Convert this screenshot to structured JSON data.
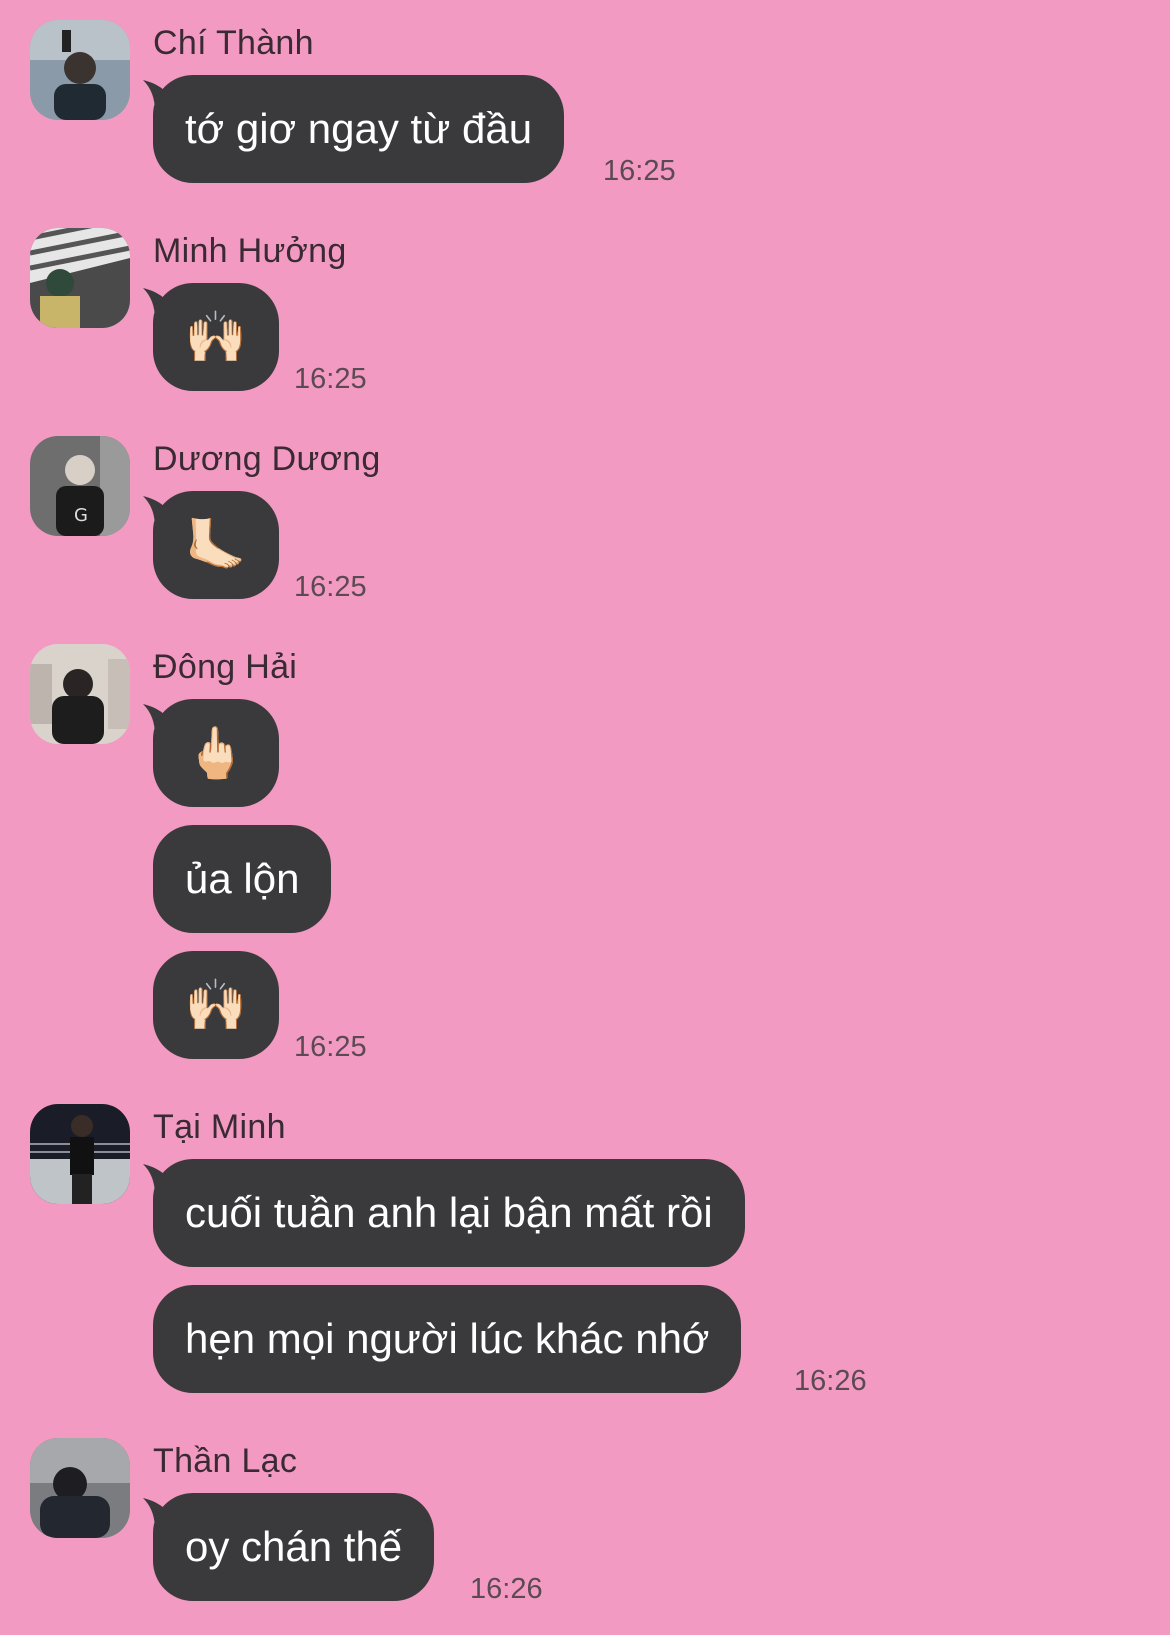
{
  "colors": {
    "background": "#f29ac2",
    "bubble": "#3a3a3c",
    "bubble_text": "#ffffff",
    "sender_text": "#3a2a33",
    "time_text": "#5b4a53"
  },
  "messages": [
    {
      "sender": "Chí Thành",
      "bubbles": [
        "tớ giơ ngay từ đầu"
      ],
      "time": "16:25"
    },
    {
      "sender": "Minh Hưởng",
      "bubbles": [
        "🙌🏻"
      ],
      "time": "16:25"
    },
    {
      "sender": "Dương Dương",
      "bubbles": [
        "🦶🏻"
      ],
      "time": "16:25"
    },
    {
      "sender": "Đông Hải",
      "bubbles": [
        "🖕🏻",
        "ủa lộn",
        "🙌🏻"
      ],
      "time": "16:25"
    },
    {
      "sender": "Tại Minh",
      "bubbles": [
        "cuối tuần anh lại bận mất rồi",
        "hẹn mọi người lúc khác nhớ"
      ],
      "time": "16:26"
    },
    {
      "sender": "Thần Lạc",
      "bubbles": [
        "oy chán thế"
      ],
      "time": "16:26"
    }
  ]
}
